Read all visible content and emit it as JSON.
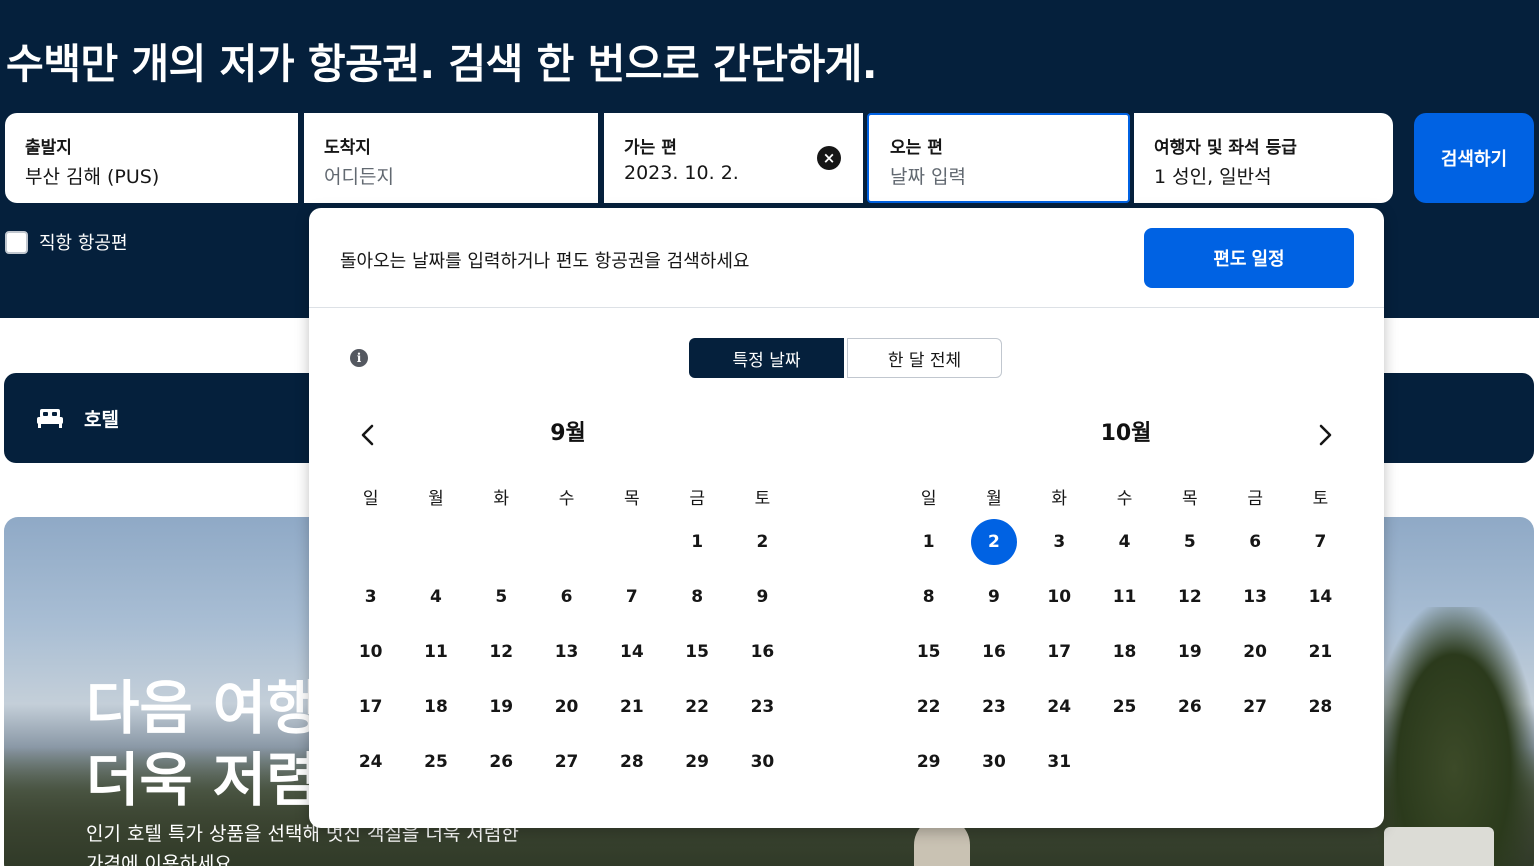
{
  "headline": "수백만 개의 저가 항공권. 검색 한 번으로 간단하게.",
  "search": {
    "origin": {
      "label": "출발지",
      "value": "부산 김해 (PUS)"
    },
    "destination": {
      "label": "도착지",
      "placeholder": "어디든지"
    },
    "depart": {
      "label": "가는 편",
      "value": "2023. 10. 2."
    },
    "return": {
      "label": "오는 편",
      "placeholder": "날짜 입력"
    },
    "travellers": {
      "label": "여행자 및 좌석 등급",
      "value": "1 성인, 일반석"
    },
    "search_button": "검색하기",
    "direct_flights": "직항 항공편"
  },
  "hotel_bar": {
    "label": "호텔",
    "icon": "bed-icon"
  },
  "promo": {
    "title_line1": "다음 여행",
    "title_line2": "더욱 저렴",
    "subtitle": "인기 호텔 특가 상품을 선택해 멋진 객실을 더욱 저렴한 가격에 이용하세요"
  },
  "calendar_popup": {
    "message": "돌아오는 날짜를 입력하거나 편도 항공권을 검색하세요",
    "oneway_button": "편도 일정",
    "mode_specific": "특정 날짜",
    "mode_month": "한 달 전체",
    "weekdays": [
      "일",
      "월",
      "화",
      "수",
      "목",
      "금",
      "토"
    ],
    "months": [
      {
        "title": "9월",
        "days": [
          "",
          "",
          "",
          "",
          "",
          "1",
          "2",
          "3",
          "4",
          "5",
          "6",
          "7",
          "8",
          "9",
          "10",
          "11",
          "12",
          "13",
          "14",
          "15",
          "16",
          "17",
          "18",
          "19",
          "20",
          "21",
          "22",
          "23",
          "24",
          "25",
          "26",
          "27",
          "28",
          "29",
          "30"
        ]
      },
      {
        "title": "10월",
        "selected_day": "2",
        "days": [
          "1",
          "2",
          "3",
          "4",
          "5",
          "6",
          "7",
          "8",
          "9",
          "10",
          "11",
          "12",
          "13",
          "14",
          "15",
          "16",
          "17",
          "18",
          "19",
          "20",
          "21",
          "22",
          "23",
          "24",
          "25",
          "26",
          "27",
          "28",
          "29",
          "30",
          "31"
        ]
      }
    ]
  },
  "colors": {
    "navy": "#05203c",
    "accent": "#0062e3"
  }
}
